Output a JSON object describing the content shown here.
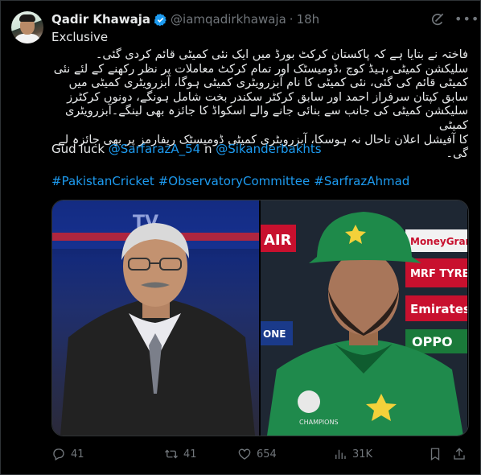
{
  "author": {
    "name": "Qadir Khawaja",
    "handle": "@iamqadirkhawaja",
    "separator": "·",
    "time": "18h"
  },
  "tweet": {
    "lead": "Exclusive",
    "urdu_lines": [
      "فاختہ نے بتایا ہے کہ پاکستان کرکٹ بورڈ میں ایک نئی کمیٹی قائم کردی گئی۔",
      "سلیکشن کمیٹی ،ہیڈ کوچ ،ڈومیسٹک اور تمام کرکٹ معاملات پر نظر رکھنے کے لئے نئی",
      "کمیٹی قائم کی گئی، نئی کمیٹی کا نام آبزرویٹری کمیٹی ہوگا، آبزرویٹری کمیٹی میں",
      "سابق کپتان سرفراز احمد اور سابق کرکٹر سکندر بخت شامل ہونگے، دونوں کرکٹرز",
      "سلیکشن کمیٹی کی جانب سے بنائی جانے والے اسکواڈ کا جائزہ بھی لینگے۔آبزرویٹری کمیٹی",
      "کا آفیشل اعلان تاحال نہ ہوسکا، آبزرویٹری کمیٹی ڈومیسٹک ریفارمز پر بھی جائزہ لے گی۔"
    ],
    "closing_prefix": "Gud luck ",
    "mention_1": "@SarfarazA_54",
    "closing_joiner": " n ",
    "mention_2": "@Sikanderbakhts",
    "hashtags": [
      "#PakistanCricket",
      "#ObservatoryCommittee",
      "#SarfrazAhmad"
    ]
  },
  "media": {
    "left_banner": "TV",
    "right_sponsors": [
      "AIR",
      "MoneyGram",
      "MRF TYRES",
      "Emirates",
      "OPPO",
      "ONE"
    ],
    "badge_text": "CHAMPIONS"
  },
  "stats": {
    "replies": "41",
    "reposts": "41",
    "likes": "654",
    "views": "31K"
  },
  "colors": {
    "link": "#1d9bf0",
    "muted": "#71767b",
    "verified": "#1d9bf0"
  }
}
